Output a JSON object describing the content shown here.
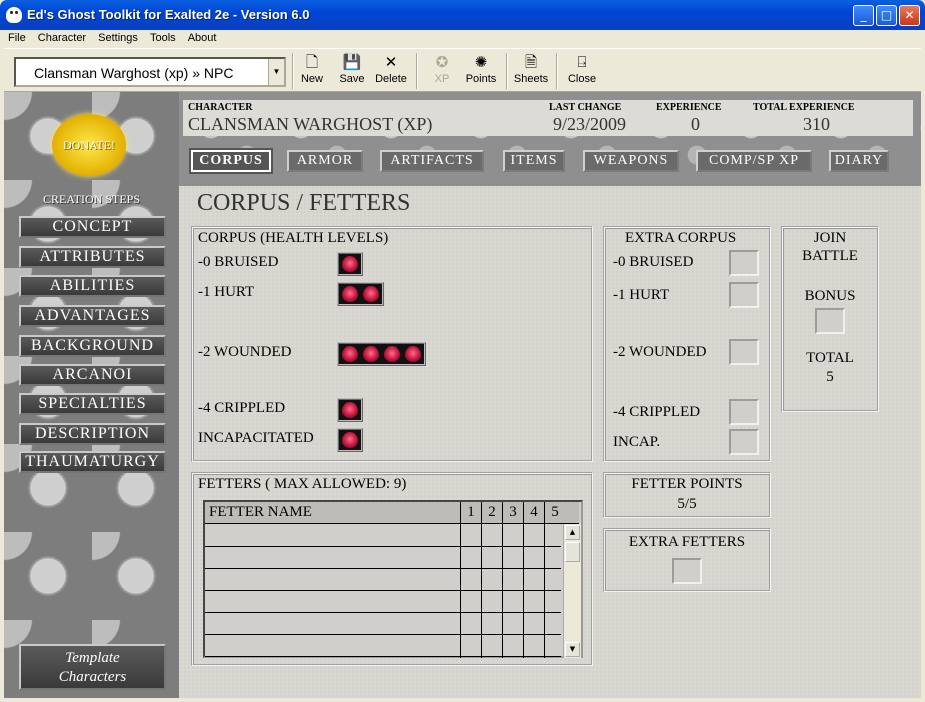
{
  "window": {
    "title": "Ed's Ghost Toolkit for Exalted 2e - Version 6.0",
    "buttons": [
      "_",
      "□",
      "✕"
    ]
  },
  "menu": [
    "File",
    "Character",
    "Settings",
    "Tools",
    "About"
  ],
  "toolbar": {
    "character_select": "Clansman Warghost (xp) » NPC",
    "buttons": [
      {
        "label": "New",
        "icon": "new-document-icon",
        "glyph": "🗋",
        "enabled": true
      },
      {
        "label": "Save",
        "icon": "floppy-disk-icon",
        "glyph": "💾",
        "enabled": true
      },
      {
        "label": "Delete",
        "icon": "delete-x-icon",
        "glyph": "✕",
        "enabled": true
      },
      {
        "label": "XP",
        "icon": "xp-icon",
        "glyph": "✪",
        "enabled": false
      },
      {
        "label": "Points",
        "icon": "points-icon",
        "glyph": "✺",
        "enabled": true
      },
      {
        "label": "Sheets",
        "icon": "sheets-icon",
        "glyph": "🗎",
        "enabled": true
      },
      {
        "label": "Close",
        "icon": "close-door-icon",
        "glyph": "⍈",
        "enabled": true
      }
    ]
  },
  "sidebar": {
    "donate": "DONATE!",
    "steps_header": "CREATION STEPS",
    "steps": [
      "Concept",
      "Attributes",
      "Abilities",
      "Advantages",
      "Background",
      "Arcanoi",
      "Specialties",
      "Description",
      "Thaumaturgy"
    ],
    "template_button": [
      "Template",
      "Characters"
    ]
  },
  "header": {
    "character_label": "CHARACTER",
    "character_value": "CLANSMAN WARGHOST (XP)",
    "last_change_label": "LAST CHANGE",
    "last_change_value": "9/23/2009",
    "experience_label": "EXPERIENCE",
    "experience_value": "0",
    "total_experience_label": "TOTAL EXPERIENCE",
    "total_experience_value": "310"
  },
  "tabs": [
    "Corpus",
    "Armor",
    "Artifacts",
    "Items",
    "Weapons",
    "Comp/Sp XP",
    "Diary"
  ],
  "active_tab": "Corpus",
  "page_title": "CORPUS / FETTERS",
  "corpus": {
    "title": "CORPUS (HEALTH LEVELS)",
    "levels": [
      {
        "label": "-0 BRUISED",
        "hearts": 1
      },
      {
        "label": "-1 HURT",
        "hearts": 2
      },
      {
        "label": "-2 WOUNDED",
        "hearts": 4
      },
      {
        "label": "-4 CRIPPLED",
        "hearts": 1
      },
      {
        "label": "INCAPACITATED",
        "hearts": 1
      }
    ]
  },
  "extra_corpus": {
    "title": "EXTRA CORPUS",
    "levels": [
      "-0 BRUISED",
      "-1 HURT",
      "-2 WOUNDED",
      "-4 CRIPPLED",
      "INCAP."
    ]
  },
  "join_battle": {
    "title_1": "JOIN",
    "title_2": "BATTLE",
    "bonus_label": "BONUS",
    "total_label": "TOTAL",
    "total_value": "5"
  },
  "fetters": {
    "title": "FETTERS ( MAX ALLOWED: 9)",
    "columns": [
      "FETTER NAME",
      "1",
      "2",
      "3",
      "4",
      "5"
    ],
    "rows": 6
  },
  "fetter_points": {
    "label": "FETTER POINTS",
    "value": "5/5"
  },
  "extra_fetters": {
    "label": "EXTRA FETTERS"
  }
}
